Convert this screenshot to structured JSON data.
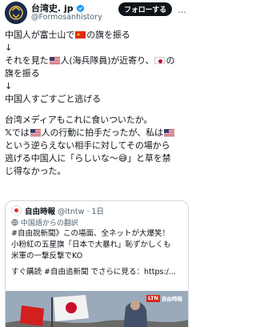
{
  "header": {
    "display_name": "台湾史. jp",
    "handle": "@Formosanhistory",
    "follow_label": "フォローする",
    "more_label": "…"
  },
  "post_lines": [
    "中国人が富士山で",
    "の旗を振る",
    "↓",
    "それを見た",
    "人(海兵隊員)が近寄り、",
    "の",
    "旗を振る",
    "↓",
    "中国人すごすごと逃げる",
    "台湾メディアもこれに食いついたか。",
    "では",
    "人の行動に拍手だったが、私は",
    "という逆らえない相手に対してその場から",
    "逃げる中国人に「らしいな〜",
    "」と草を禁",
    "じ得なかった。"
  ],
  "emoji": {
    "x_logo": "𝕏",
    "smile": "😅"
  },
  "quote": {
    "name": "自由時報",
    "handle": "@ltntw",
    "time": "· 1日",
    "translated": "中国語からの翻訳",
    "lines": [
      "#自由說新聞》この場面、全ネットが大爆笑！",
      "小粉紅の五星旗「日本で大暴れ」恥ずかしくも",
      "米軍の一撃反撃でKO",
      "すぐ購読 #自由追新聞 でさらに見る：https:/..."
    ],
    "translate_icon": "translate-icon"
  },
  "video": {
    "badge": "LTN",
    "source_text": "自由時報"
  },
  "colors": {
    "follow_bg": "#0f1419",
    "verified": "#1d9bf0",
    "border": "#cfd9de",
    "muted": "#536471"
  }
}
